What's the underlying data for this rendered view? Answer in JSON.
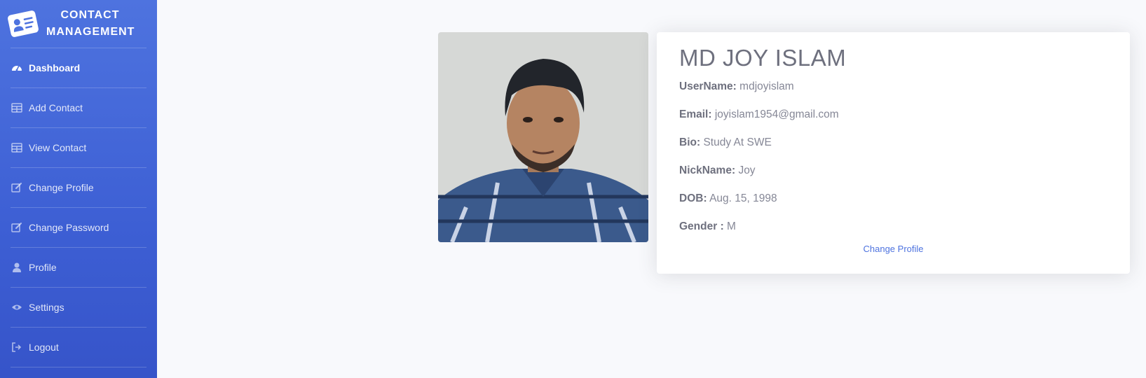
{
  "sidebar": {
    "brand": {
      "line1": "CONTACT",
      "line2": "MANAGEMENT",
      "logo_icon": "contact-card-icon"
    },
    "items": [
      {
        "label": "Dashboard",
        "icon": "tachometer-icon",
        "active": true
      },
      {
        "label": "Add Contact",
        "icon": "table-icon"
      },
      {
        "label": "View Contact",
        "icon": "table-icon"
      },
      {
        "label": "Change Profile",
        "icon": "edit-icon"
      },
      {
        "label": "Change Password",
        "icon": "edit-icon"
      },
      {
        "label": "Profile",
        "icon": "user-icon"
      },
      {
        "label": "Settings",
        "icon": "eye-icon"
      },
      {
        "label": "Logout",
        "icon": "sign-out-icon"
      }
    ]
  },
  "profile": {
    "name": "MD JOY ISLAM",
    "fields": [
      {
        "label": "UserName:",
        "value": "mdjoyislam"
      },
      {
        "label": "Email:",
        "value": "joyislam1954@gmail.com"
      },
      {
        "label": "Bio:",
        "value": "Study At SWE"
      },
      {
        "label": "NickName:",
        "value": "Joy"
      },
      {
        "label": "DOB:",
        "value": "Aug. 15, 1998"
      },
      {
        "label": "Gender :",
        "value": "M"
      }
    ],
    "change_link": "Change Profile"
  },
  "colors": {
    "sidebar": "#4e73df",
    "background": "#f8f9fc",
    "link": "#4e73df",
    "text": "#858796"
  }
}
